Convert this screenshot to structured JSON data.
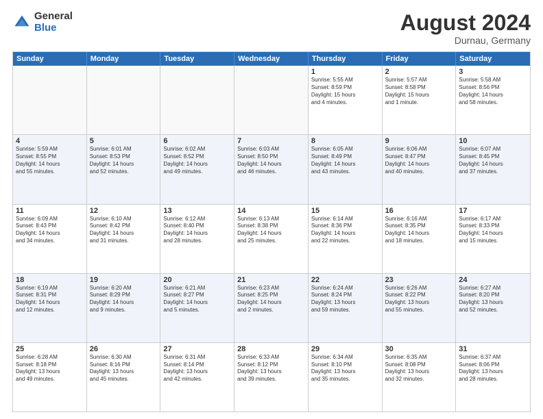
{
  "header": {
    "logo_general": "General",
    "logo_blue": "Blue",
    "month_year": "August 2024",
    "location": "Durnau, Germany"
  },
  "calendar": {
    "days": [
      "Sunday",
      "Monday",
      "Tuesday",
      "Wednesday",
      "Thursday",
      "Friday",
      "Saturday"
    ],
    "rows": [
      [
        {
          "day": "",
          "info": "",
          "empty": true
        },
        {
          "day": "",
          "info": "",
          "empty": true
        },
        {
          "day": "",
          "info": "",
          "empty": true
        },
        {
          "day": "",
          "info": "",
          "empty": true
        },
        {
          "day": "1",
          "info": "Sunrise: 5:55 AM\nSunset: 8:59 PM\nDaylight: 15 hours\nand 4 minutes.",
          "empty": false
        },
        {
          "day": "2",
          "info": "Sunrise: 5:57 AM\nSunset: 8:58 PM\nDaylight: 15 hours\nand 1 minute.",
          "empty": false
        },
        {
          "day": "3",
          "info": "Sunrise: 5:58 AM\nSunset: 8:56 PM\nDaylight: 14 hours\nand 58 minutes.",
          "empty": false
        }
      ],
      [
        {
          "day": "4",
          "info": "Sunrise: 5:59 AM\nSunset: 8:55 PM\nDaylight: 14 hours\nand 55 minutes.",
          "empty": false
        },
        {
          "day": "5",
          "info": "Sunrise: 6:01 AM\nSunset: 8:53 PM\nDaylight: 14 hours\nand 52 minutes.",
          "empty": false
        },
        {
          "day": "6",
          "info": "Sunrise: 6:02 AM\nSunset: 8:52 PM\nDaylight: 14 hours\nand 49 minutes.",
          "empty": false
        },
        {
          "day": "7",
          "info": "Sunrise: 6:03 AM\nSunset: 8:50 PM\nDaylight: 14 hours\nand 46 minutes.",
          "empty": false
        },
        {
          "day": "8",
          "info": "Sunrise: 6:05 AM\nSunset: 8:49 PM\nDaylight: 14 hours\nand 43 minutes.",
          "empty": false
        },
        {
          "day": "9",
          "info": "Sunrise: 6:06 AM\nSunset: 8:47 PM\nDaylight: 14 hours\nand 40 minutes.",
          "empty": false
        },
        {
          "day": "10",
          "info": "Sunrise: 6:07 AM\nSunset: 8:45 PM\nDaylight: 14 hours\nand 37 minutes.",
          "empty": false
        }
      ],
      [
        {
          "day": "11",
          "info": "Sunrise: 6:09 AM\nSunset: 8:43 PM\nDaylight: 14 hours\nand 34 minutes.",
          "empty": false
        },
        {
          "day": "12",
          "info": "Sunrise: 6:10 AM\nSunset: 8:42 PM\nDaylight: 14 hours\nand 31 minutes.",
          "empty": false
        },
        {
          "day": "13",
          "info": "Sunrise: 6:12 AM\nSunset: 8:40 PM\nDaylight: 14 hours\nand 28 minutes.",
          "empty": false
        },
        {
          "day": "14",
          "info": "Sunrise: 6:13 AM\nSunset: 8:38 PM\nDaylight: 14 hours\nand 25 minutes.",
          "empty": false
        },
        {
          "day": "15",
          "info": "Sunrise: 6:14 AM\nSunset: 8:36 PM\nDaylight: 14 hours\nand 22 minutes.",
          "empty": false
        },
        {
          "day": "16",
          "info": "Sunrise: 6:16 AM\nSunset: 8:35 PM\nDaylight: 14 hours\nand 18 minutes.",
          "empty": false
        },
        {
          "day": "17",
          "info": "Sunrise: 6:17 AM\nSunset: 8:33 PM\nDaylight: 14 hours\nand 15 minutes.",
          "empty": false
        }
      ],
      [
        {
          "day": "18",
          "info": "Sunrise: 6:19 AM\nSunset: 8:31 PM\nDaylight: 14 hours\nand 12 minutes.",
          "empty": false
        },
        {
          "day": "19",
          "info": "Sunrise: 6:20 AM\nSunset: 8:29 PM\nDaylight: 14 hours\nand 9 minutes.",
          "empty": false
        },
        {
          "day": "20",
          "info": "Sunrise: 6:21 AM\nSunset: 8:27 PM\nDaylight: 14 hours\nand 5 minutes.",
          "empty": false
        },
        {
          "day": "21",
          "info": "Sunrise: 6:23 AM\nSunset: 8:25 PM\nDaylight: 14 hours\nand 2 minutes.",
          "empty": false
        },
        {
          "day": "22",
          "info": "Sunrise: 6:24 AM\nSunset: 8:24 PM\nDaylight: 13 hours\nand 59 minutes.",
          "empty": false
        },
        {
          "day": "23",
          "info": "Sunrise: 6:26 AM\nSunset: 8:22 PM\nDaylight: 13 hours\nand 55 minutes.",
          "empty": false
        },
        {
          "day": "24",
          "info": "Sunrise: 6:27 AM\nSunset: 8:20 PM\nDaylight: 13 hours\nand 52 minutes.",
          "empty": false
        }
      ],
      [
        {
          "day": "25",
          "info": "Sunrise: 6:28 AM\nSunset: 8:18 PM\nDaylight: 13 hours\nand 49 minutes.",
          "empty": false
        },
        {
          "day": "26",
          "info": "Sunrise: 6:30 AM\nSunset: 8:16 PM\nDaylight: 13 hours\nand 45 minutes.",
          "empty": false
        },
        {
          "day": "27",
          "info": "Sunrise: 6:31 AM\nSunset: 8:14 PM\nDaylight: 13 hours\nand 42 minutes.",
          "empty": false
        },
        {
          "day": "28",
          "info": "Sunrise: 6:33 AM\nSunset: 8:12 PM\nDaylight: 13 hours\nand 39 minutes.",
          "empty": false
        },
        {
          "day": "29",
          "info": "Sunrise: 6:34 AM\nSunset: 8:10 PM\nDaylight: 13 hours\nand 35 minutes.",
          "empty": false
        },
        {
          "day": "30",
          "info": "Sunrise: 6:35 AM\nSunset: 8:08 PM\nDaylight: 13 hours\nand 32 minutes.",
          "empty": false
        },
        {
          "day": "31",
          "info": "Sunrise: 6:37 AM\nSunset: 8:06 PM\nDaylight: 13 hours\nand 28 minutes.",
          "empty": false
        }
      ]
    ]
  }
}
